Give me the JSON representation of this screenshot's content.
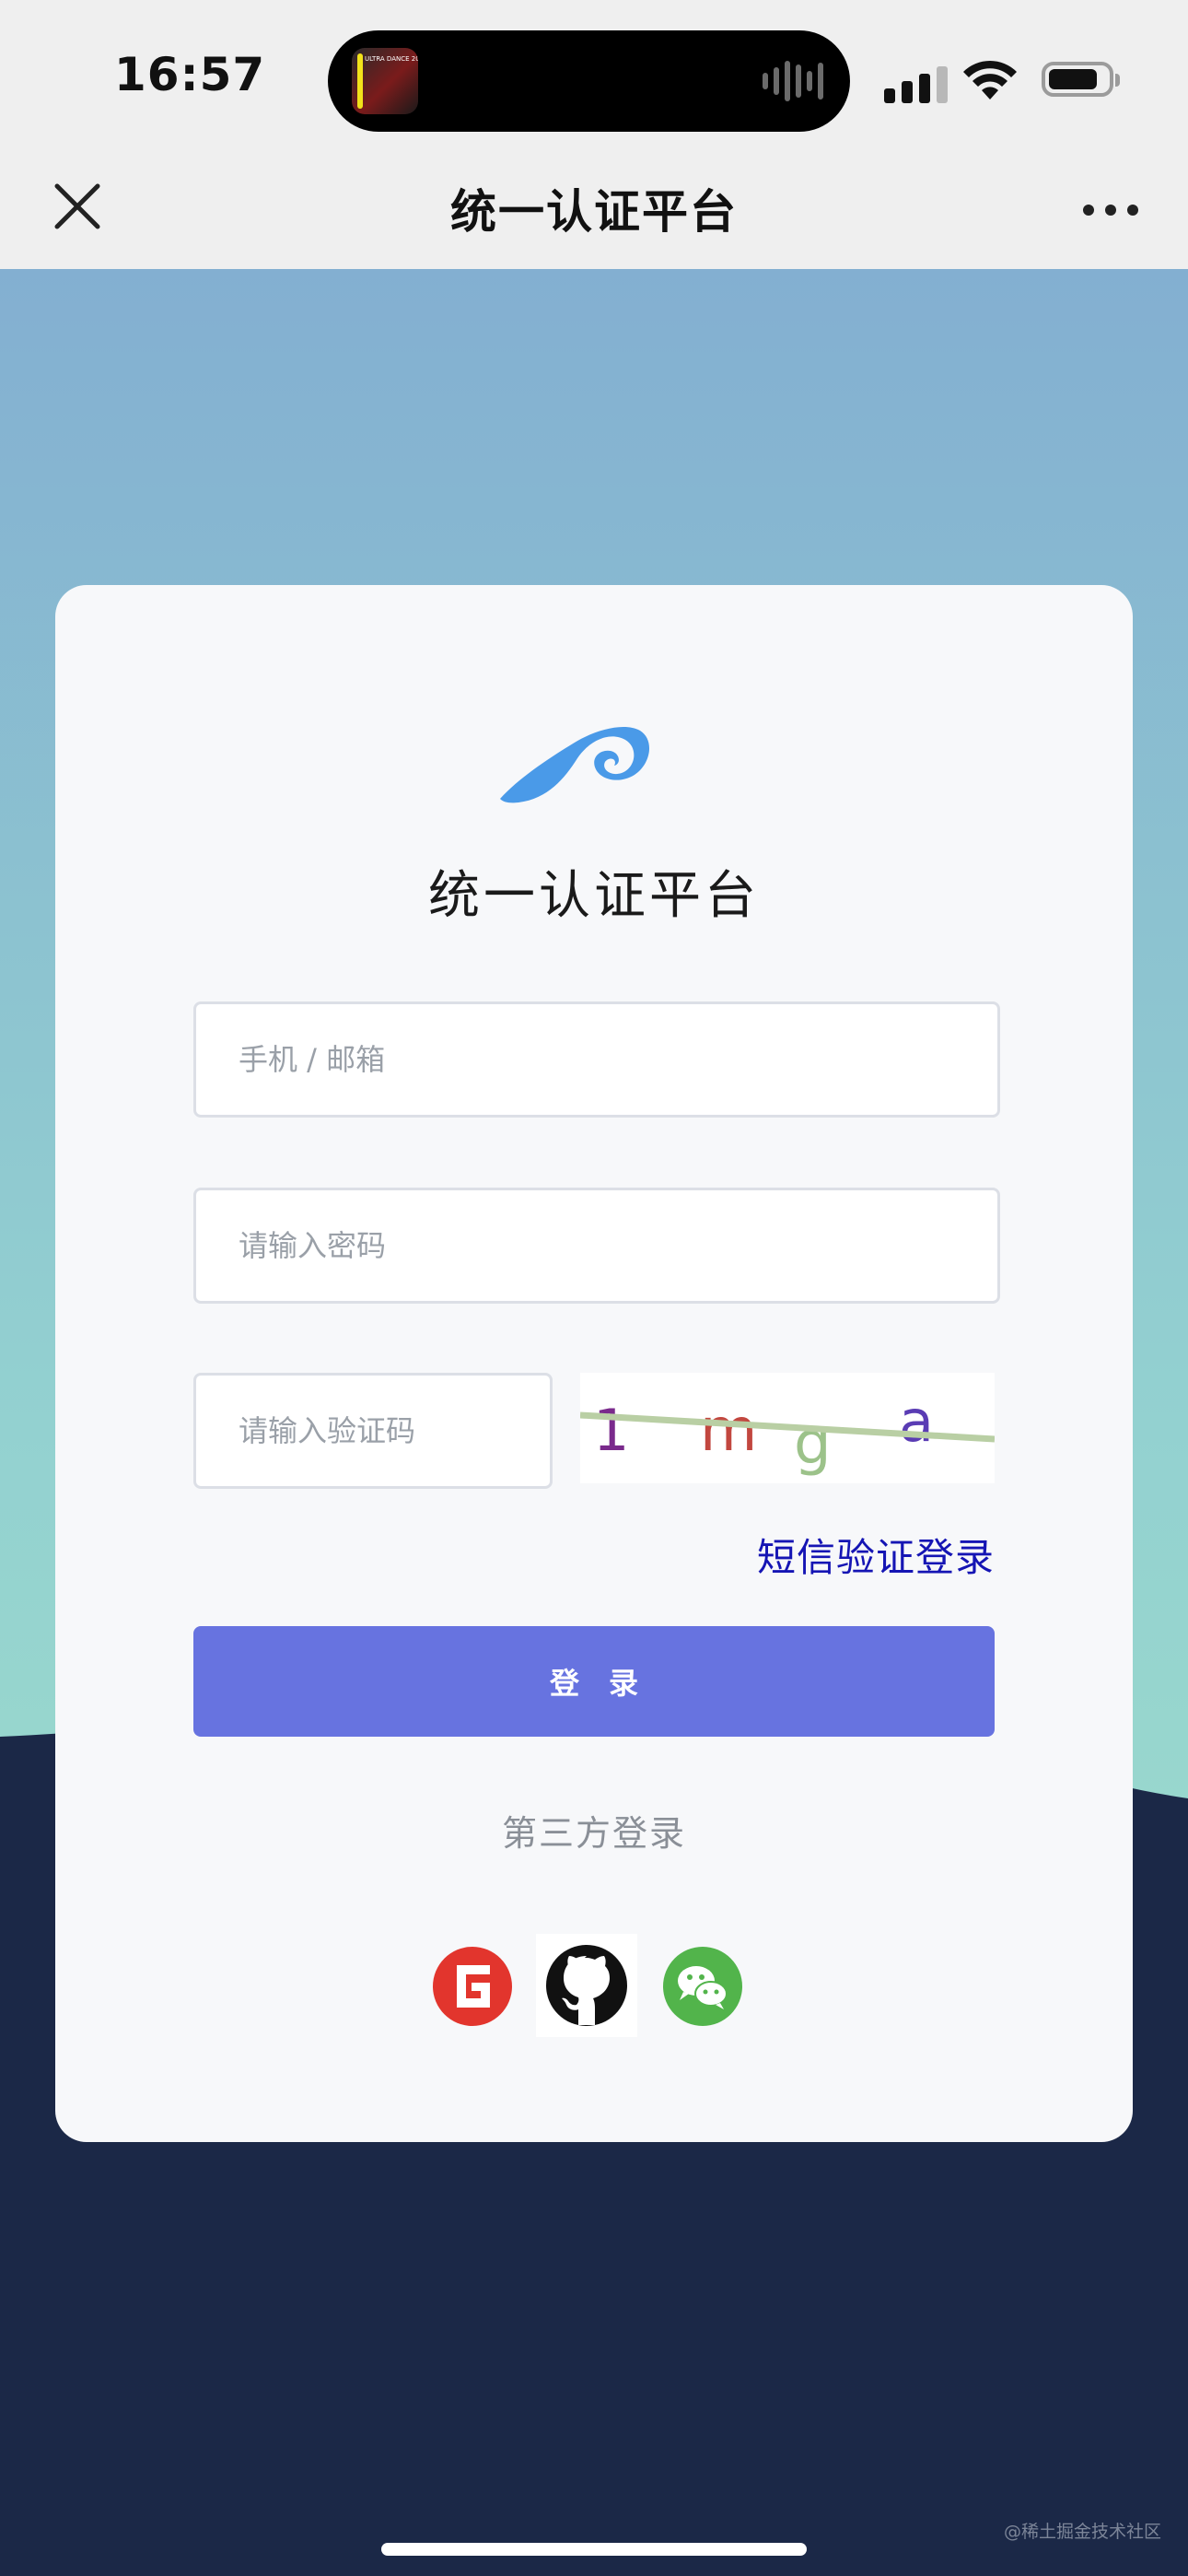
{
  "status_bar": {
    "time": "16:57",
    "now_playing_art": "ULTRA DANCE 2019"
  },
  "nav": {
    "title": "统一认证平台"
  },
  "card": {
    "title": "统一认证平台",
    "account_placeholder": "手机 / 邮箱",
    "password_placeholder": "请输入密码",
    "captcha_placeholder": "请输入验证码",
    "captcha_chars": [
      "1",
      "m",
      "g",
      "a"
    ],
    "sms_login_link": "短信验证登录",
    "login_button": "登　录",
    "third_party_label": "第三方登录",
    "social_providers": [
      "gitee",
      "github",
      "wechat"
    ]
  },
  "watermark": "@稀土掘金技术社区",
  "colors": {
    "sky_top": "#86b0d2",
    "sky_bottom": "#9ee1c9",
    "dark_navy": "#1b2847",
    "primary_button": "#6773e0",
    "link": "#1515b4",
    "logo": "#4a9ae8"
  }
}
